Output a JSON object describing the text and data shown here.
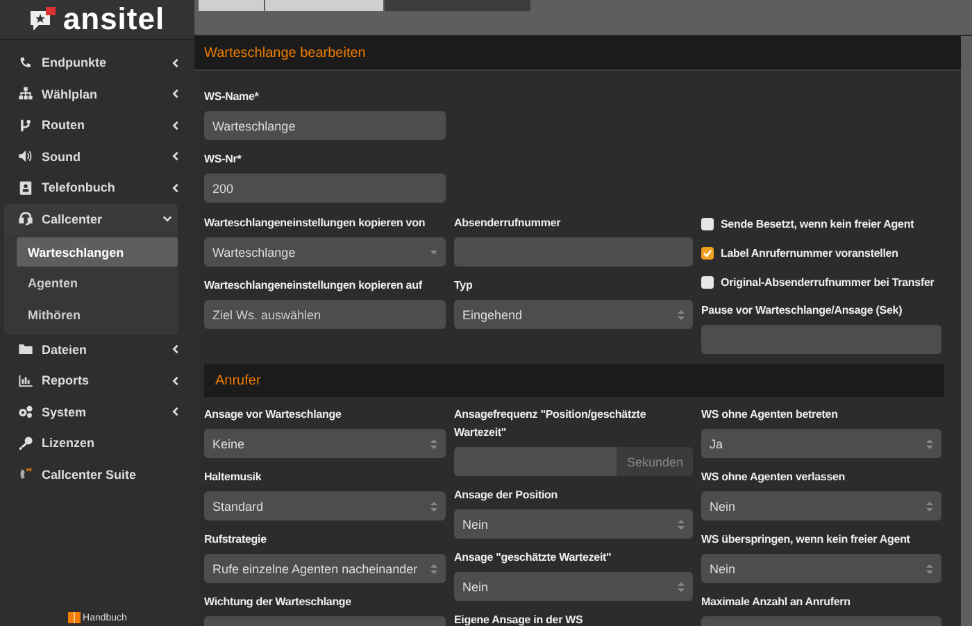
{
  "logo": {
    "text": "ansitel"
  },
  "sidebar": {
    "items": [
      {
        "label": "Endpunkte",
        "kind": "group",
        "expanded": false
      },
      {
        "label": "Wählplan",
        "kind": "group",
        "expanded": false
      },
      {
        "label": "Routen",
        "kind": "group",
        "expanded": false
      },
      {
        "label": "Sound",
        "kind": "group",
        "expanded": false
      },
      {
        "label": "Telefonbuch",
        "kind": "group",
        "expanded": false
      },
      {
        "label": "Callcenter",
        "kind": "group",
        "expanded": true,
        "children": [
          {
            "label": "Warteschlangen",
            "selected": true
          },
          {
            "label": "Agenten",
            "selected": false
          },
          {
            "label": "Mithören",
            "selected": false
          }
        ]
      },
      {
        "label": "Dateien",
        "kind": "group",
        "expanded": false
      },
      {
        "label": "Reports",
        "kind": "group",
        "expanded": false
      },
      {
        "label": "System",
        "kind": "group",
        "expanded": false
      },
      {
        "label": "Lizenzen",
        "kind": "link"
      },
      {
        "label": "Callcenter Suite",
        "kind": "link"
      }
    ],
    "footer": "Handbuch"
  },
  "breadcrumbs": [
    {
      "selected": false
    },
    {
      "selected": false
    },
    {
      "selected": true
    }
  ],
  "panel": {
    "title": "Warteschlange bearbeiten",
    "top_fields": [
      {
        "label": "WS-Name*",
        "kind": "text",
        "value": "Warteschlange"
      },
      {
        "label": "WS-Nr*",
        "kind": "text",
        "value": "200"
      }
    ],
    "columns": [
      [
        {
          "label": "Warteschlangeneinstellungen kopieren von",
          "kind": "dropdown",
          "value": "Warteschlange"
        },
        {
          "label": "Warteschlangeneinstellungen kopieren auf",
          "kind": "text",
          "placeholder": "Ziel Ws. auswählen"
        }
      ],
      [
        {
          "label": "Absenderrufnummer",
          "kind": "text"
        },
        {
          "label": "Typ",
          "kind": "select",
          "value": "Eingehend"
        }
      ],
      [
        {
          "label": "Sende Besetzt, wenn kein freier Agent",
          "kind": "checkbox",
          "checked": false
        },
        {
          "label": "Label Anrufernummer voranstellen",
          "kind": "checkbox",
          "checked": true
        },
        {
          "label": "Original-Absenderrufnummer bei Transfer",
          "kind": "checkbox",
          "checked": false
        },
        {
          "label": "Pause vor Warteschlange/Ansage (Sek)",
          "kind": "text"
        }
      ]
    ]
  },
  "caller_section": {
    "title": "Anrufer",
    "columns": [
      [
        {
          "label": "Ansage vor Warteschlange",
          "kind": "select",
          "value": "Keine"
        },
        {
          "label": "Haltemusik",
          "kind": "select",
          "value": "Standard"
        },
        {
          "label": "Rufstrategie",
          "kind": "select",
          "value": "Rufe einzelne Agenten nacheinander"
        },
        {
          "label": "Wichtung der Warteschlange",
          "kind": "text"
        }
      ],
      [
        {
          "label": "Ansagefrequenz \"Position/geschätzte Wartezeit\"",
          "kind": "addon",
          "addon": "Sekunden"
        },
        {
          "label": "Ansage der Position",
          "kind": "select",
          "value": "Nein"
        },
        {
          "label": "Ansage \"geschätzte Wartezeit\"",
          "kind": "select",
          "value": "Nein"
        },
        {
          "label": "Eigene Ansage in der WS",
          "kind": "label"
        }
      ],
      [
        {
          "label": "WS ohne Agenten betreten",
          "kind": "select",
          "value": "Ja"
        },
        {
          "label": "WS ohne Agenten verlassen",
          "kind": "select",
          "value": "Nein"
        },
        {
          "label": "WS überspringen, wenn kein freier Agent",
          "kind": "select",
          "value": "Nein"
        },
        {
          "label": "Maximale Anzahl an Anrufern",
          "kind": "text"
        }
      ]
    ]
  }
}
